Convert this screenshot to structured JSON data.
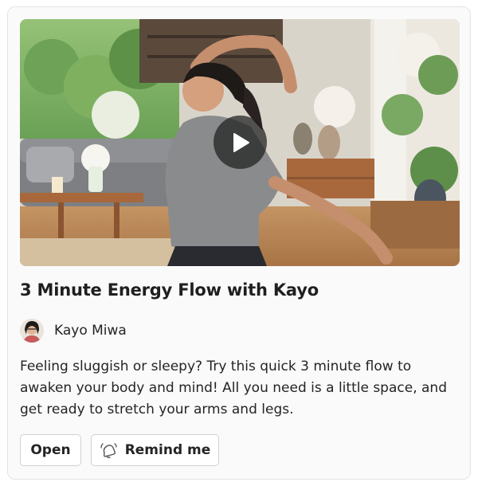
{
  "video": {
    "title": "3 Minute Energy Flow with Kayo",
    "thumbnail_alt": "Woman doing a yoga stretch in a bright living room with plants",
    "play_icon": "play-icon"
  },
  "author": {
    "name": "Kayo Miwa",
    "avatar_icon": "avatar"
  },
  "description": "Feeling sluggish or sleepy? Try this quick 3 minute flow to awaken your body and mind! All you need is a little space, and get ready to stretch your arms and legs.",
  "actions": {
    "open_label": "Open",
    "remind_label": "Remind me",
    "remind_icon": "bell-ringing-icon"
  },
  "colors": {
    "card_bg": "#fafafa",
    "text": "#242424",
    "border": "#d1d1d1"
  }
}
